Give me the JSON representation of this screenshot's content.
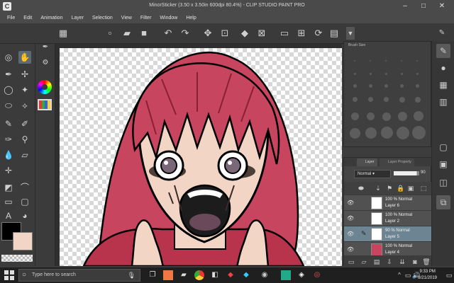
{
  "window": {
    "title": "MinorSticker (3.50 x 3.50in 600dpi 80.4%) - CLIP STUDIO PAINT PRO",
    "app_icon": "C"
  },
  "menu": [
    "File",
    "Edit",
    "Animation",
    "Layer",
    "Selection",
    "View",
    "Filter",
    "Window",
    "Help"
  ],
  "brush_panel": {
    "tab_label": "Brush Size"
  },
  "layer_panel": {
    "tabs": [
      "Layer",
      "Layer Property"
    ],
    "blend_mode": "Normal",
    "opacity": "90",
    "layers": [
      {
        "percent": "100 %",
        "mode": "Normal",
        "name": "Layer 6",
        "selected": false
      },
      {
        "percent": "100 %",
        "mode": "Normal",
        "name": "Layer 2",
        "selected": false
      },
      {
        "percent": "90 %",
        "mode": "Normal",
        "name": "Layer 5",
        "selected": true
      },
      {
        "percent": "100 %",
        "mode": "Normal",
        "name": "Layer 4",
        "selected": false
      }
    ]
  },
  "colors": {
    "main": "#000000",
    "sub": "#f2d5c4",
    "hair": "#c8455f",
    "skin": "#f2d5c4",
    "selected_layer": "#6d8492"
  },
  "taskbar": {
    "search_placeholder": "Type here to search",
    "time": "9:33 PM",
    "date": "8/21/2019"
  }
}
